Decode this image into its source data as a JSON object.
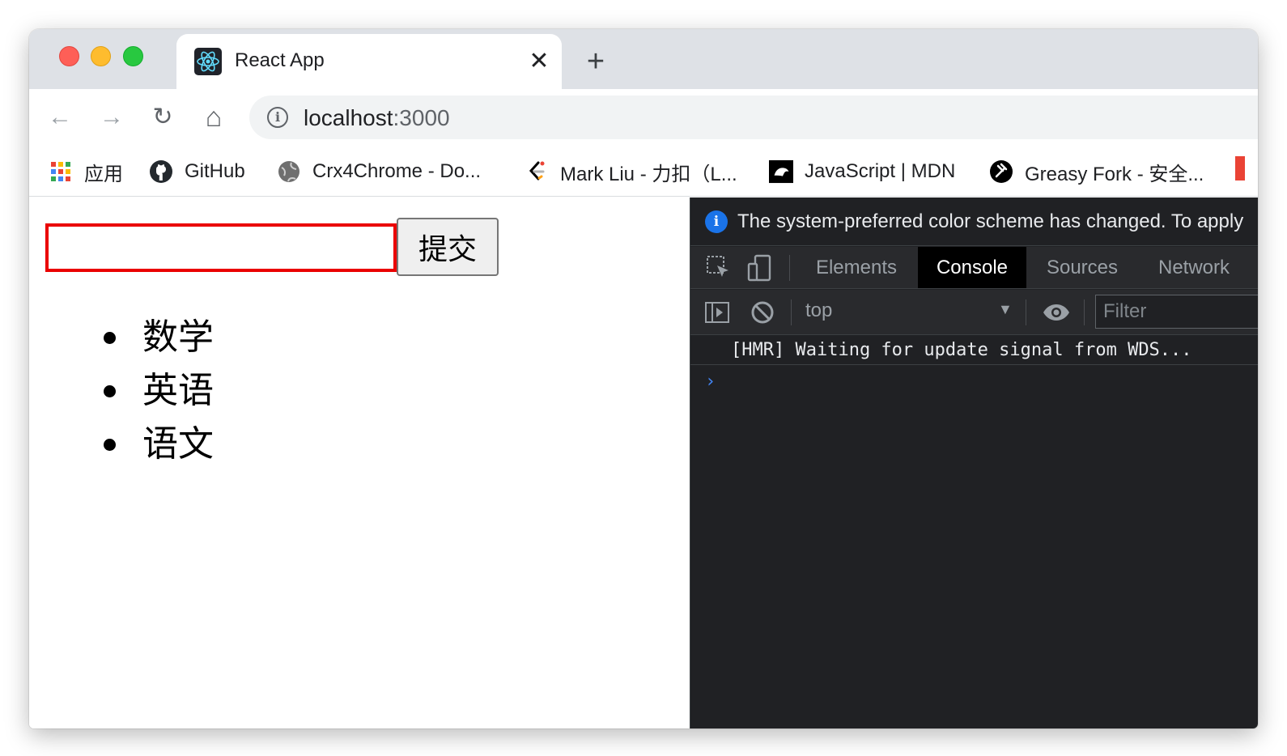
{
  "browser": {
    "tab": {
      "title": "React App",
      "close_glyph": "✕"
    },
    "newtab_glyph": "+",
    "nav": {
      "back": "←",
      "forward": "→",
      "reload": "↻",
      "home": "⌂"
    },
    "address": {
      "host": "localhost",
      "port": ":3000",
      "info_icon": "i"
    },
    "bookmarks": [
      {
        "label": "应用",
        "icon": "apps-grid-icon"
      },
      {
        "label": "GitHub",
        "icon": "github-icon"
      },
      {
        "label": "Crx4Chrome - Do...",
        "icon": "globe-icon"
      },
      {
        "label": "Mark Liu - 力扣（L...",
        "icon": "leetcode-icon"
      },
      {
        "label": "JavaScript | MDN",
        "icon": "mdn-icon"
      },
      {
        "label": "Greasy Fork - 安全...",
        "icon": "greasyfork-icon"
      }
    ]
  },
  "page": {
    "input_value": "",
    "submit_label": "提交",
    "items": [
      "数学",
      "英语",
      "语文"
    ]
  },
  "devtools": {
    "info_message": "The system-preferred color scheme has changed. To apply",
    "tabs": [
      "Elements",
      "Console",
      "Sources",
      "Network"
    ],
    "active_tab": "Console",
    "context": "top",
    "filter_placeholder": "Filter",
    "log_line": "[HMR] Waiting for update signal from WDS...",
    "prompt": "›"
  },
  "colors": {
    "input_border": "#ea0000",
    "devtools_bg": "#202124",
    "accent_blue": "#1a73e8"
  }
}
